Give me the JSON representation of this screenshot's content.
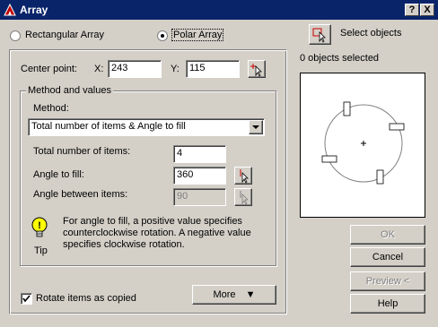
{
  "window": {
    "title": "Array",
    "help_btn": "?",
    "close_btn": "X"
  },
  "array_type": {
    "rectangular_label": "Rectangular Array",
    "polar_label": "Polar Array",
    "selected": "polar"
  },
  "center_point": {
    "label": "Center point:",
    "x_label": "X:",
    "x_value": "243",
    "y_label": "Y:",
    "y_value": "115"
  },
  "method_group": {
    "title": "Method and values",
    "method_label": "Method:",
    "method_value": "Total number of items & Angle to fill",
    "total_items_label": "Total number of items:",
    "total_items_value": "4",
    "angle_fill_label": "Angle to fill:",
    "angle_fill_value": "360",
    "angle_between_label": "Angle between items:",
    "angle_between_value": "90"
  },
  "tip": {
    "label": "Tip",
    "lines": [
      "For angle to fill, a positive value specifies",
      "counterclockwise rotation.  A negative value",
      "specifies clockwise rotation."
    ]
  },
  "rotate_items": {
    "label": "Rotate items as copied",
    "checked": true
  },
  "more_button": "More",
  "select_objects": {
    "label": "Select objects",
    "count_text": "0 objects selected"
  },
  "buttons": {
    "ok": "OK",
    "cancel": "Cancel",
    "preview": "Preview <",
    "help": "Help"
  }
}
